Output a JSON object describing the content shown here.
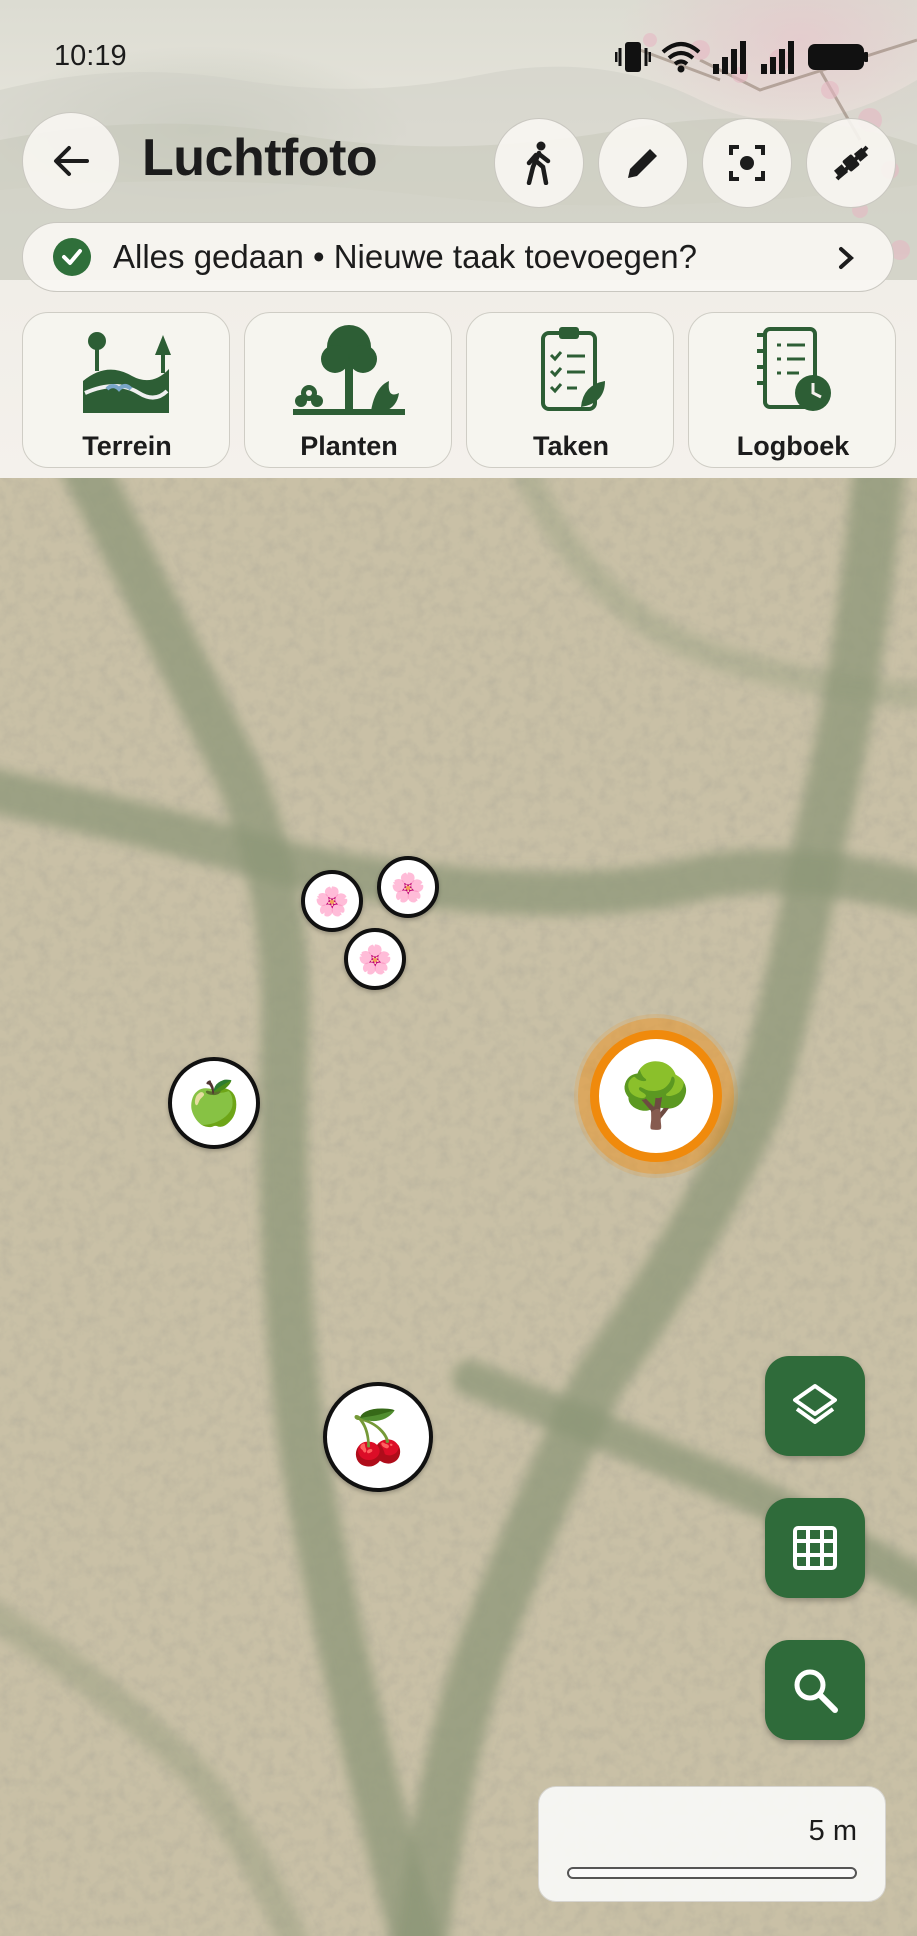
{
  "status_bar": {
    "time": "10:19"
  },
  "header": {
    "title": "Luchtfoto",
    "back_icon": "arrow-left-icon",
    "actions": [
      {
        "name": "walk",
        "icon": "walking-person-icon"
      },
      {
        "name": "edit",
        "icon": "pencil-icon"
      },
      {
        "name": "center",
        "icon": "focus-target-icon"
      },
      {
        "name": "gps-off",
        "icon": "satellite-off-icon"
      }
    ]
  },
  "task_bar": {
    "text": "Alles gedaan • Nieuwe taak toevoegen?",
    "icon": "check-circle-icon"
  },
  "categories": [
    {
      "label": "Terrein",
      "icon": "terrain-icon"
    },
    {
      "label": "Planten",
      "icon": "plants-icon"
    },
    {
      "label": "Taken",
      "icon": "clipboard-checklist-icon"
    },
    {
      "label": "Logboek",
      "icon": "logbook-clock-icon"
    }
  ],
  "map": {
    "markers": [
      {
        "name": "blossom",
        "emoji": "🌸"
      },
      {
        "name": "blossom",
        "emoji": "🌸"
      },
      {
        "name": "blossom",
        "emoji": "🌸"
      },
      {
        "name": "apple",
        "emoji": "🍏"
      },
      {
        "name": "tree",
        "emoji": "🌳",
        "selected": true
      },
      {
        "name": "cherry",
        "emoji": "🍒"
      }
    ],
    "controls": [
      {
        "name": "layers",
        "icon": "layers-icon"
      },
      {
        "name": "grid",
        "icon": "grid-icon"
      },
      {
        "name": "search",
        "icon": "search-icon"
      }
    ],
    "scale": "5 m"
  },
  "colors": {
    "accent": "#2f6b3a",
    "selected": "#f08a0c"
  }
}
